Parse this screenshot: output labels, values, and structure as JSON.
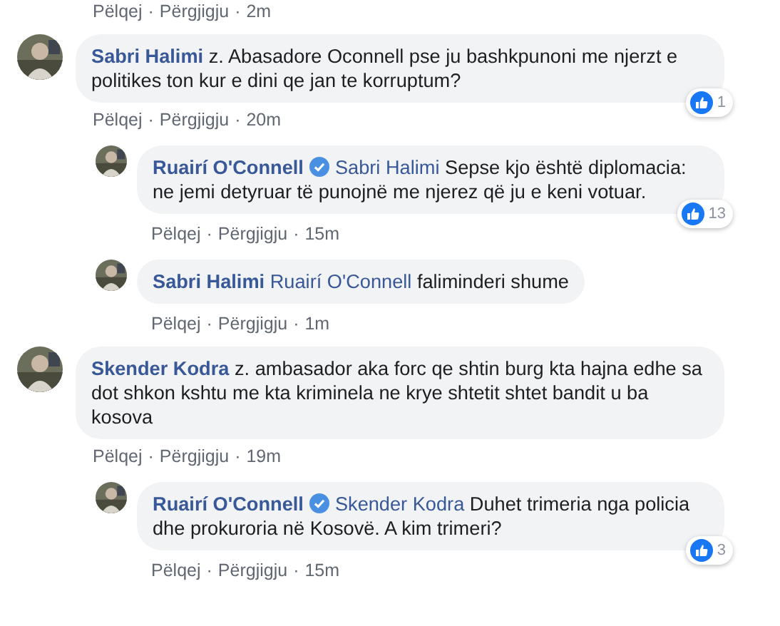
{
  "separator": "·",
  "top_actions": {
    "like": "Pëlqej",
    "reply": "Përgjigju",
    "time": "2m"
  },
  "comments": [
    {
      "author": "Sabri Halimi",
      "verified": false,
      "text": "z. Abasadore Oconnell pse ju bashkpunoni me njerzt e politikes ton kur e dini qe jan te korruptum?",
      "actions": {
        "like": "Pëlqej",
        "reply": "Përgjigju",
        "time": "20m"
      },
      "reactions": {
        "count": "1"
      },
      "replies": [
        {
          "author": "Ruairí O'Connell",
          "verified": true,
          "mention": "Sabri Halimi",
          "text": "Sepse kjo është diplomacia: ne jemi detyruar të punojnë me njerez që ju e keni votuar.",
          "actions": {
            "like": "Pëlqej",
            "reply": "Përgjigju",
            "time": "15m"
          },
          "reactions": {
            "count": "13"
          }
        },
        {
          "author": "Sabri Halimi",
          "verified": false,
          "mention": "Ruairí O'Connell",
          "text": "faliminderi shume",
          "actions": {
            "like": "Pëlqej",
            "reply": "Përgjigju",
            "time": "1m"
          }
        }
      ]
    },
    {
      "author": "Skender Kodra",
      "verified": false,
      "text": "z. ambasador aka forc qe shtin burg kta hajna edhe sa dot shkon kshtu me kta kriminela ne krye shtetit shtet bandit u ba kosova",
      "actions": {
        "like": "Pëlqej",
        "reply": "Përgjigju",
        "time": "19m"
      },
      "replies": [
        {
          "author": "Ruairí O'Connell",
          "verified": true,
          "mention": "Skender Kodra",
          "text": "Duhet trimeria nga policia dhe prokuroria në Kosovë. A kim trimeri?",
          "actions": {
            "like": "Pëlqej",
            "reply": "Përgjigju",
            "time": "15m"
          },
          "reactions": {
            "count": "3"
          }
        }
      ]
    }
  ]
}
